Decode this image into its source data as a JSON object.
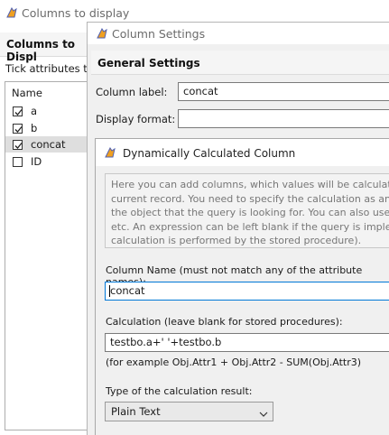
{
  "colors": {
    "accent": "#0078d7",
    "window_bg": "#f0f0f0",
    "section_band": "#f5f5f5"
  },
  "columns_window": {
    "title": "Columns to display",
    "header": "Columns to Displ",
    "hint": "Tick attributes to c",
    "list_header": "Name",
    "items": [
      {
        "label": "a",
        "checked": true
      },
      {
        "label": "b",
        "checked": true
      },
      {
        "label": "concat",
        "checked": true
      },
      {
        "label": "ID",
        "checked": false
      }
    ]
  },
  "column_settings": {
    "title": "Column Settings",
    "section": "General Settings",
    "column_label": "Column label:",
    "column_label_value": "concat",
    "display_format": "Display format:",
    "display_format_value": ""
  },
  "calc_dialog": {
    "title": "Dynamically Calculated Column",
    "hint_lines": [
      "Here you can add columns, which values will be calculated dy",
      "current record. You need to specify the calculation as an arithm",
      "the object that the query is looking for. You can also use aggre",
      "etc. An expression can be left blank if the query is implemente",
      "calculation is performed by the stored procedure)."
    ],
    "column_name_label": "Column Name (must not match any of the attribute names):",
    "column_name_value": "concat",
    "calculation_label": "Calculation (leave blank for stored procedures):",
    "calculation_value": "testbo.a+' '+testbo.b",
    "example": "(for example Obj.Attr1 + Obj.Attr2 - SUM(Obj.Attr3)",
    "result_type_label": "Type of the calculation result:",
    "result_type_value": "Plain Text"
  }
}
